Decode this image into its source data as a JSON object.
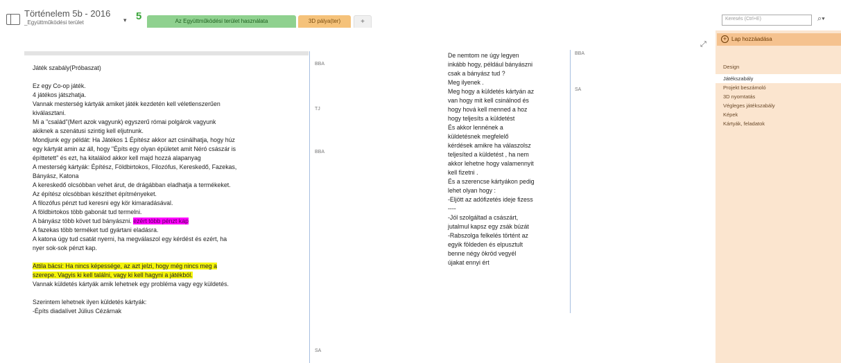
{
  "header": {
    "notebook_title": "Történelem 5b - 2016",
    "notebook_subtitle": "_Együttműködési terület",
    "dropdown_glyph": "▾",
    "sync_badge": "5",
    "tabs": [
      {
        "label": "Az Együttműködési terület használata"
      },
      {
        "label": "3D pálya(ter)"
      },
      {
        "label": "+"
      }
    ],
    "search_placeholder": "Keresés (Ctrl+E)",
    "search_icon": "magnifier-icon"
  },
  "note1": {
    "lines": [
      "Játék szabály(Próbaszat)",
      "",
      "Ez egy Co-op játék.",
      "4 játékos játszhatja.",
      "Vannak mesterség kártyák amiket  játék kezdetén kell véletlenszerűen",
      "kiválasztani.",
      "Mi a \"család\"(Mert azok vagyunk) egyszerű római polgárok vagyunk",
      "akiknek a szenátusi szintig kell eljutnunk.",
      "Mondjunk egy példát: Ha Játékos 1 Építész akkor azt csinálhatja, hogy húz",
      "egy kártyát amin az áll, hogy \"Építs egy olyan épületet amit Néró császár is",
      "építtetett\" és ezt, ha kitalálod akkor kell majd hozzá alapanyag",
      "A mesterség kártyák: Építész, Földbirtokos, Filozófus, Kereskedő, Fazekas,",
      "Bányász, Katona",
      "A kereskedő olcsóbban vehet árut, de drágábban eladhatja a termékeket.",
      "Az építész olcsóbban készíthet építményeket.",
      "A filozófus pénzt tud keresni egy kör kimaradásával.",
      "A földbirtokos több gabonát tud termelni.",
      "A bányász több követ tud bányászni.",
      "A fazekas több terméket tud gyártani eladásra.",
      "A katona úgy tud csatát nyerni, ha megválaszol egy kérdést és ezért, ha",
      "nyer sok-sok pénzt kap.",
      "",
      "Attila bácsi: Ha nincs képessége, az azt jelzi, hogy még nincs meg a",
      "szerepe. Vagyis ki kell találni, vagy ki kell hagyni a játékból.",
      "Vannak küldetés kártyák amik lehetnek egy probléma vagy egy küldetés.",
      "",
      "Szerintem lehetnek ilyen küldetés kártyák:",
      "-Építs diadalívet Július Cézárnak"
    ],
    "magenta_highlight": "ezért több pénzt kap",
    "underlined_word": "Építész"
  },
  "note1_marks": [
    {
      "text": "BBA"
    },
    {
      "text": "TJ"
    },
    {
      "text": "BBA"
    },
    {
      "text": "SA"
    }
  ],
  "note2": {
    "lines": [
      "De nemtom ne úgy legyen",
      "inkább hogy, például bányászni",
      "csak a bányász tud ?",
      "Meg ilyenek .",
      "Meg hogy a küldetés kártyán az",
      "van hogy mit kell csinálnod és",
      "hogy hová kell menned a hoz",
      "hogy teljesíts a küldetést",
      "És akkor lennének a",
      "küldetésnek megfelelő",
      "kérdések amikre ha válaszolsz",
      "teljesíted a küldetést , ha nem",
      "akkor lehetne hogy valamennyit",
      "kell fizetni  .",
      "És a szerencse kártyákon pedig",
      "lehet olyan hogy :",
      "-Eljött az adófizetés ideje fizess",
      "----",
      "-Jól szolgáltad a császárt,",
      "jutalmul kapsz egy zsák búzát",
      "-Rabszolga felkelés történt az",
      "egyik földeden és elpusztult",
      "benne négy ökröd  vegyél",
      "újakat ennyi ért"
    ]
  },
  "note2_marks": [
    {
      "text": "BBA"
    },
    {
      "text": "SA"
    }
  ],
  "sidebar": {
    "add_page_label": "Lap hozzáadása",
    "pages": [
      {
        "label": "Design",
        "active": false
      },
      {
        "label": "Játékszabály",
        "active": true
      },
      {
        "label": "Projekt beszámoló",
        "active": false
      },
      {
        "label": "3D nyomtatás",
        "active": false
      },
      {
        "label": "Végleges játékszabály",
        "active": false
      },
      {
        "label": "Képek",
        "active": false
      },
      {
        "label": "Kártyák, feladatok",
        "active": false
      }
    ]
  },
  "colors": {
    "green_tab": "#8fd18f",
    "orange_tab": "#f5c27a",
    "sidebar_bg": "#fbe5cf",
    "highlight_yellow": "#f4f40a",
    "highlight_magenta": "#ff00ff"
  }
}
